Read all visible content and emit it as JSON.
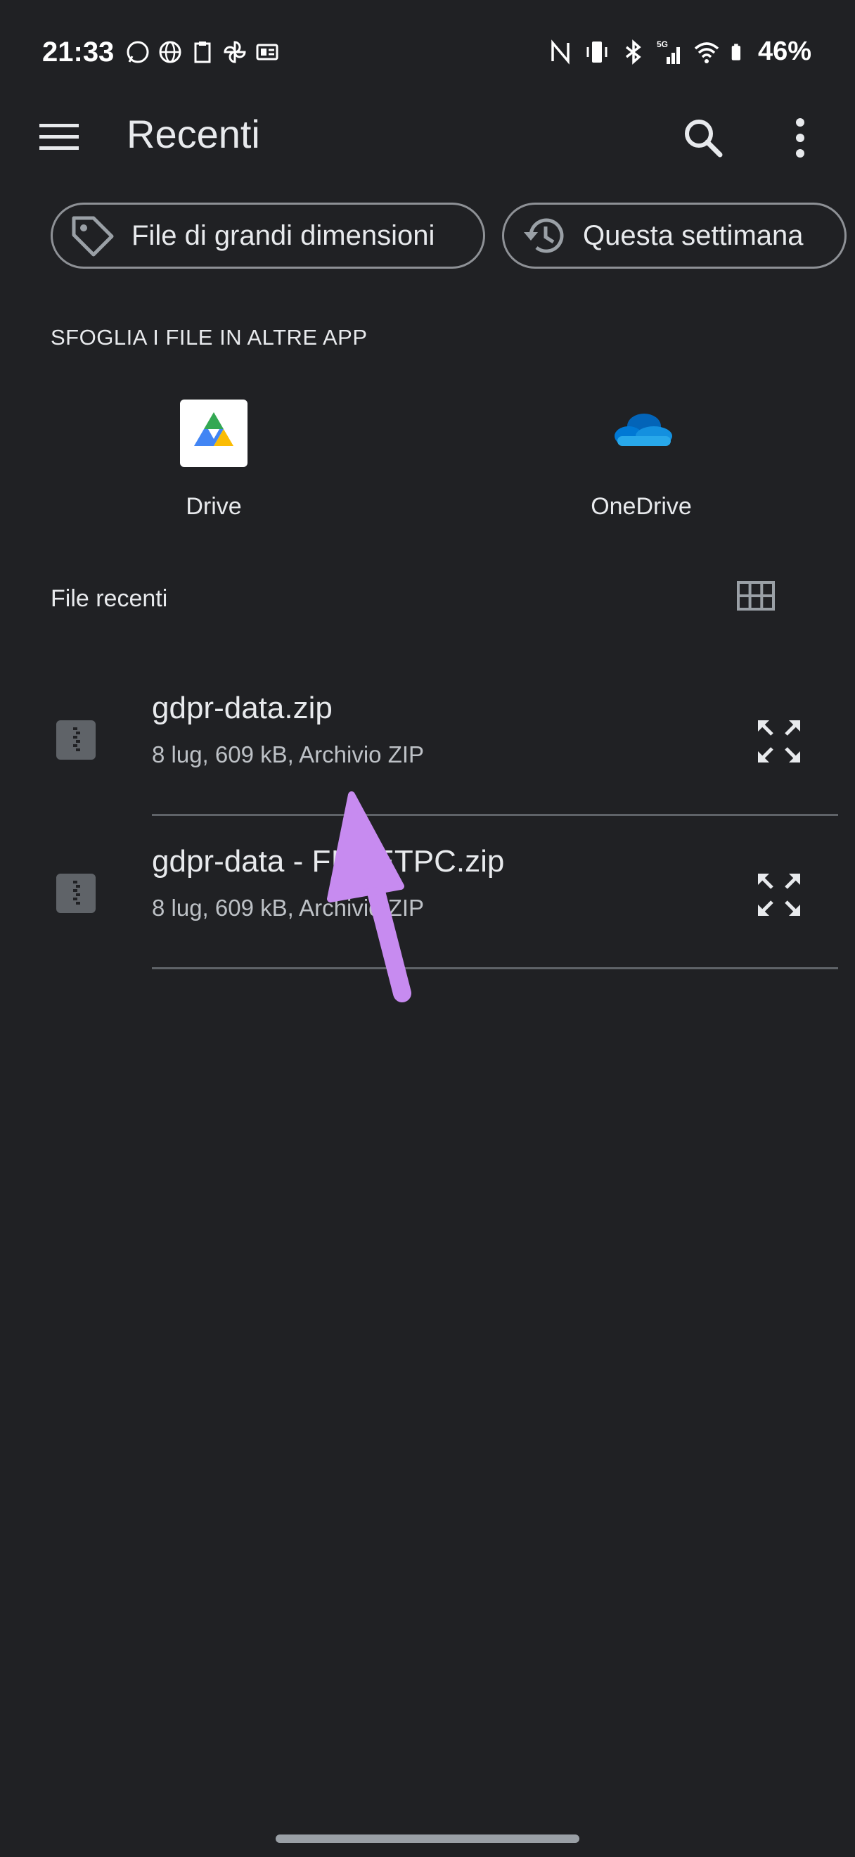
{
  "status_bar": {
    "time": "21:33",
    "battery": "46%",
    "network": "5G",
    "left_icons": [
      "whatsapp-icon",
      "globe-icon",
      "clipboard-icon",
      "pinwheel-icon",
      "news-icon"
    ],
    "right_icons": [
      "nfc-icon",
      "vibrate-icon",
      "bluetooth-icon",
      "signal-icon",
      "wifi-icon",
      "battery-icon"
    ]
  },
  "app_bar": {
    "title": "Recenti",
    "icons": [
      "menu-icon",
      "search-icon",
      "more-vert-icon"
    ]
  },
  "chips": [
    {
      "label": "File di grandi dimensioni",
      "icon": "label-tag-icon"
    },
    {
      "label": "Questa settimana",
      "icon": "history-icon"
    }
  ],
  "browse_section": {
    "label": "SFOGLIA I FILE IN ALTRE APP",
    "apps": [
      {
        "label": "Drive",
        "icon": "drive-icon"
      },
      {
        "label": "OneDrive",
        "icon": "onedrive-icon"
      }
    ]
  },
  "recent": {
    "label": "File recenti",
    "view_toggle_icon": "grid-view-icon",
    "files": [
      {
        "name": "gdpr-data.zip",
        "meta": "8 lug, 609 kB, Archivio ZIP",
        "icon": "zip-file-icon"
      },
      {
        "name": "gdpr-data - FILLETPC.zip",
        "meta": "8 lug, 609 kB, Archivio ZIP",
        "icon": "zip-file-icon"
      }
    ]
  },
  "colors": {
    "background": "#202124",
    "text": "#e8eaed",
    "secondary_text": "#bdc1c6",
    "outline": "#8e9196",
    "annotation_arrow": "#c78bf0"
  }
}
